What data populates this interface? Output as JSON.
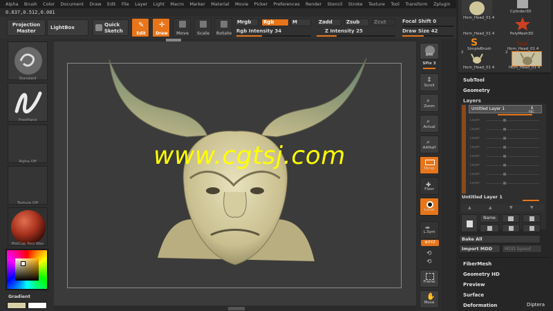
{
  "menu": [
    "Alpha",
    "Brush",
    "Color",
    "Document",
    "Draw",
    "Edit",
    "File",
    "Layer",
    "Light",
    "Macro",
    "Marker",
    "Material",
    "Movie",
    "Picker",
    "Preferences",
    "Render",
    "Stencil",
    "Stroke",
    "Texture",
    "Tool",
    "Transform",
    "Zplugin",
    "Zscript"
  ],
  "coords": "0.837,0.512,0.081",
  "toolbar": {
    "projection_master": "Projection\nMaster",
    "lightbox": "LightBox",
    "quick_sketch": "Quick\nSketch",
    "edit": "Edit",
    "draw": "Draw",
    "move": "Move",
    "scale": "Scale",
    "rotate": "Rotate",
    "mrgb": "Mrgb",
    "rgb": "Rgb",
    "m": "M",
    "rgb_intensity": "Rgb Intensity 34",
    "zadd": "Zadd",
    "zsub": "Zsub",
    "zcut": "Zcut",
    "z_intensity": "Z Intensity 25",
    "focal_shift": "Focal Shift 0",
    "draw_size": "Draw Size 42"
  },
  "sliders": {
    "rgb_intensity": 0.34,
    "z_intensity": 0.25,
    "draw_size": 0.42
  },
  "left_shelf": {
    "standard": "Standard",
    "freehand": "FreeHand",
    "alpha_off": "Alpha Off",
    "texture_off": "Texture Off",
    "matcap": "MatCap Red Wax",
    "gradient": "Gradient"
  },
  "watermark": "www.cgtsj.com",
  "right_shelf": {
    "bpr": "BPR",
    "spix": "SPix 3",
    "scroll": "Scroll",
    "zoom": "Zoom",
    "actual": "Actual",
    "aahalf": "AAHalf",
    "persp": "Persp",
    "floor": "Floor",
    "local": "Local",
    "lsym": "L.Sym",
    "xyz": "⊕XYZ",
    "frame": "Frame",
    "move": "Move"
  },
  "tray": {
    "tools": [
      {
        "label": "Horn_Head_01 4",
        "badge": ""
      },
      {
        "label": "Cylinder3D",
        "badge": ""
      },
      {
        "label": "Horn_Head_01 4",
        "badge": ""
      },
      {
        "label": "PolyMesh3D",
        "badge": ""
      },
      {
        "label": "SimpleBrush",
        "badge": ""
      },
      {
        "label": "Horn_Head_01 4",
        "badge": ""
      },
      {
        "label": "Horn_Head_01 4",
        "badge": "2"
      },
      {
        "label": "Horn_Head_01 4",
        "badge": "2"
      }
    ],
    "subtool": "SubTool",
    "geometry": "Geometry",
    "layers": "Layers",
    "layer_name": "Untitled Layer 1",
    "rec": "REC",
    "layer_rows": [
      "Layer",
      "Layer",
      "Layer",
      "Layer",
      "Layer",
      "Layer",
      "Layer",
      "Layer"
    ],
    "layer_footer": "Untitled Layer 1",
    "name_btn": "Name",
    "bake_all": "Bake All",
    "import_mdd": "Import MDD",
    "mdd_speed": "MDD Speed",
    "fibermesh": "FiberMesh",
    "geometry_hd": "Geometry HD",
    "preview": "Preview",
    "surface": "Surface",
    "deformation": "Deformation",
    "diptera": "Diptera"
  }
}
